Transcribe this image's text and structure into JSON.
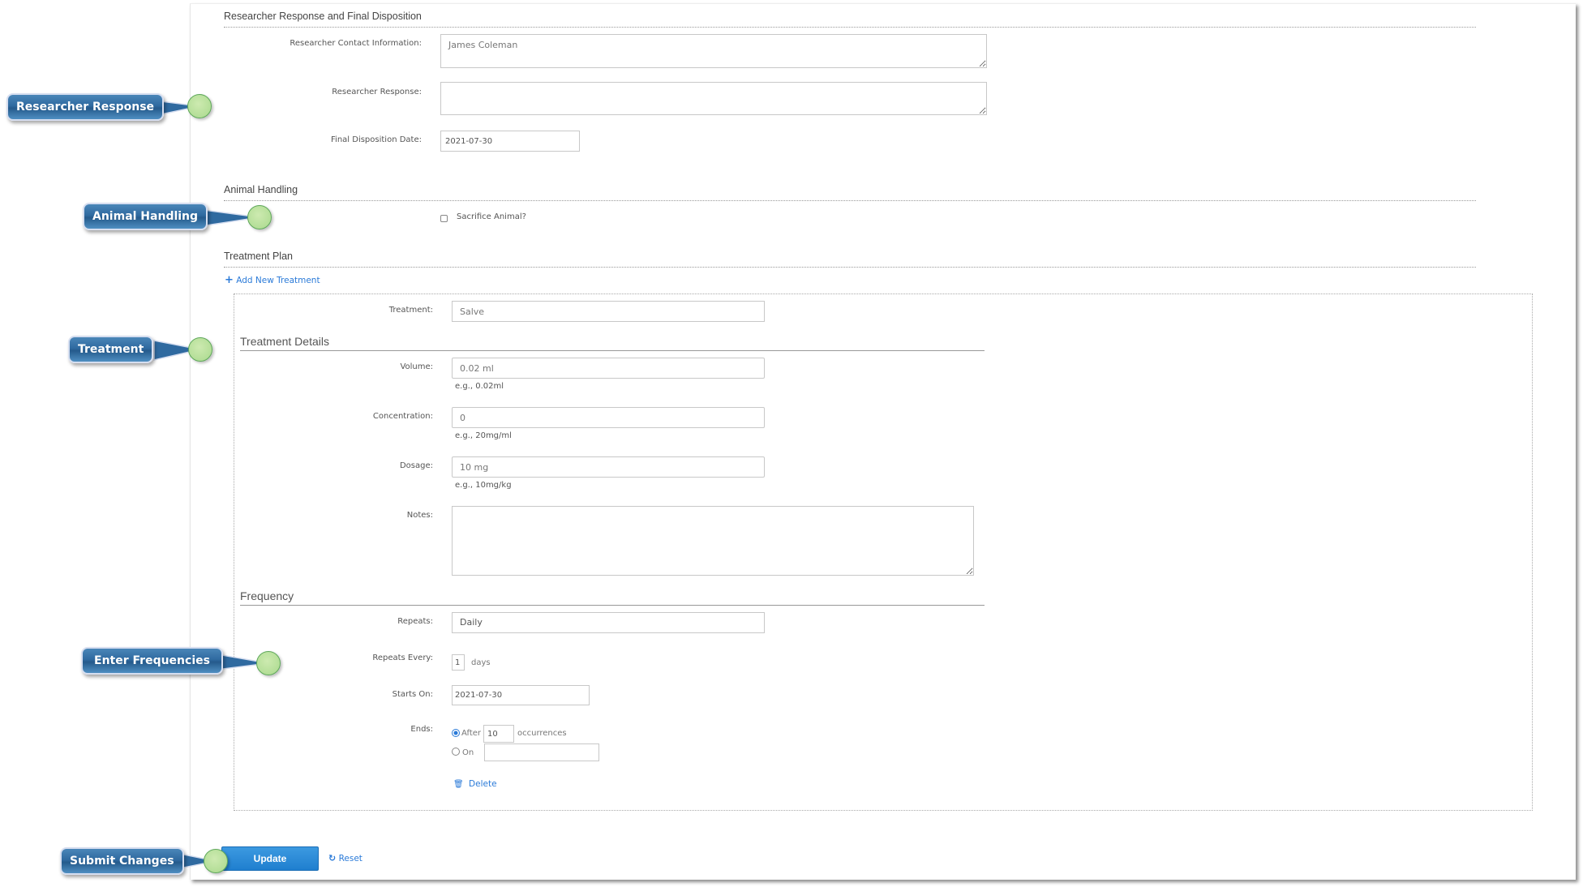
{
  "sections": {
    "researcher": {
      "title": "Researcher Response and Final Disposition",
      "contact_label": "Researcher Contact Information:",
      "contact_value": "James Coleman",
      "response_label": "Researcher Response:",
      "response_value": "",
      "disposition_label": "Final Disposition Date:",
      "disposition_value": "2021-07-30"
    },
    "animal": {
      "title": "Animal Handling",
      "sacrifice_label": "Sacrifice Animal?",
      "sacrifice_checked": false
    },
    "treatment_plan": {
      "title": "Treatment Plan",
      "add_label": "Add New Treatment",
      "treatment_label": "Treatment:",
      "treatment_value": "Salve",
      "details_title": "Treatment Details",
      "volume_label": "Volume:",
      "volume_value": "0.02 ml",
      "volume_hint": "e.g., 0.02ml",
      "concentration_label": "Concentration:",
      "concentration_value": "0",
      "concentration_hint": "e.g., 20mg/ml",
      "dosage_label": "Dosage:",
      "dosage_value": "10 mg",
      "dosage_hint": "e.g., 10mg/kg",
      "notes_label": "Notes:",
      "notes_value": "",
      "frequency_title": "Frequency",
      "repeats_label": "Repeats:",
      "repeats_value": "Daily",
      "repeats_every_label": "Repeats Every:",
      "repeats_every_value": "1",
      "repeats_every_unit": "days",
      "starts_on_label": "Starts On:",
      "starts_on_value": "2021-07-30",
      "ends_label": "Ends:",
      "ends_after_label": "After",
      "ends_after_value": "10",
      "ends_after_unit": "occurrences",
      "ends_on_label": "On",
      "ends_on_value": "",
      "ends_selected": "After",
      "delete_label": "Delete"
    }
  },
  "actions": {
    "update_label": "Update",
    "reset_label": "Reset"
  },
  "callouts": {
    "researcher_response": "Researcher Response",
    "animal_handling": "Animal Handling",
    "treatment": "Treatment",
    "enter_frequencies": "Enter Frequencies",
    "submit_changes": "Submit Changes"
  },
  "colors": {
    "link": "#2a7ad8",
    "button": "#2a88d6",
    "callout": "#2f6aa0",
    "marker": "#a9d98d"
  }
}
